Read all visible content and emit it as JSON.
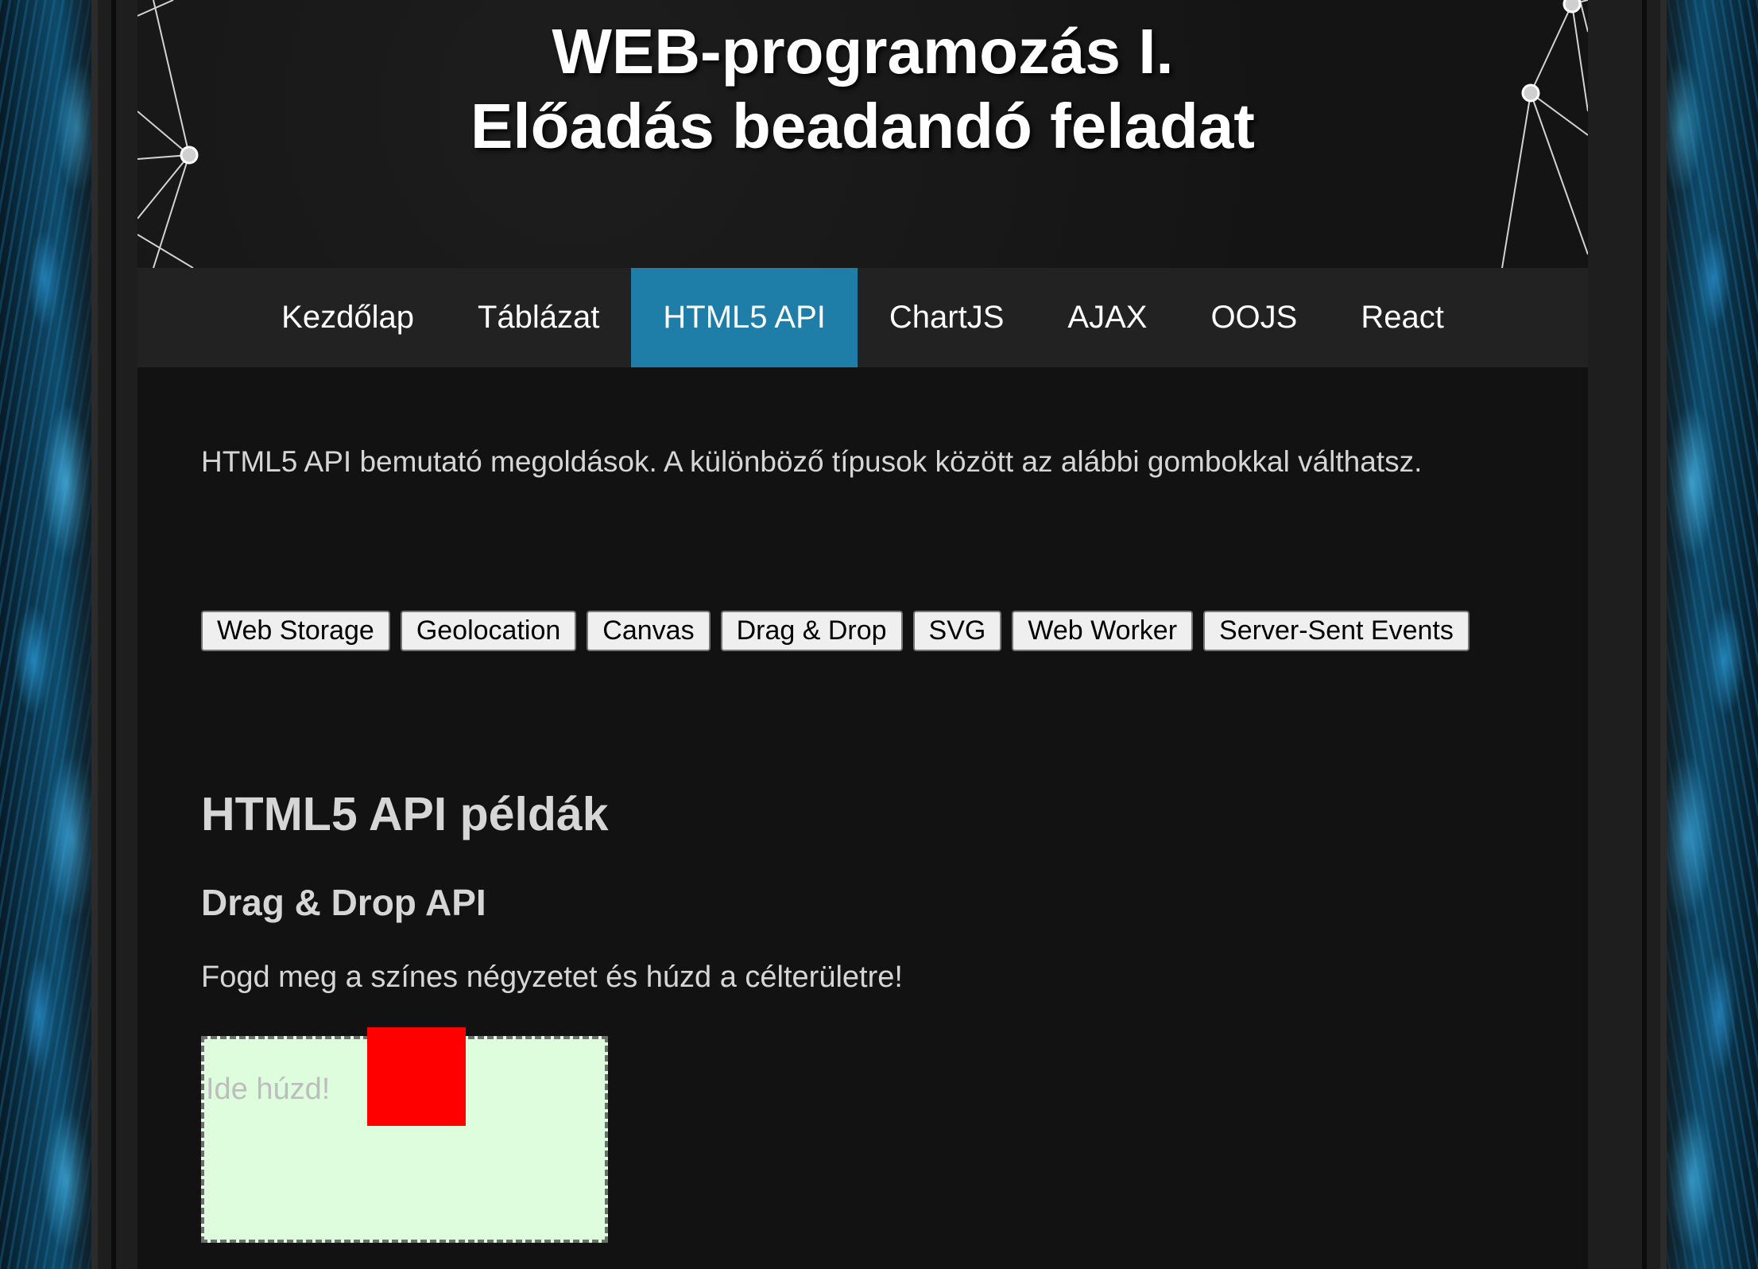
{
  "header": {
    "title_line1": "WEB-programozás I.",
    "title_line2": "Előadás beadandó feladat"
  },
  "nav": {
    "items": [
      {
        "label": "Kezdőlap",
        "active": false
      },
      {
        "label": "Táblázat",
        "active": false
      },
      {
        "label": "HTML5 API",
        "active": true
      },
      {
        "label": "ChartJS",
        "active": false
      },
      {
        "label": "AJAX",
        "active": false
      },
      {
        "label": "OOJS",
        "active": false
      },
      {
        "label": "React",
        "active": false
      }
    ],
    "active_color": "#1f7ea8"
  },
  "main": {
    "intro": "HTML5 API bemutató megoldások. A különböző típusok között az alábbi gombokkal válthatsz.",
    "api_buttons": [
      "Web Storage",
      "Geolocation",
      "Canvas",
      "Drag & Drop",
      "SVG",
      "Web Worker",
      "Server-Sent Events"
    ],
    "section_title": "HTML5 API példák",
    "sub_title": "Drag & Drop API",
    "instructions": "Fogd meg a színes négyzetet és húzd a célterületre!",
    "drop_zone": {
      "label": "Ide húzd!",
      "background": "#ddfddd"
    },
    "drag_item": {
      "color": "#ff0000"
    }
  },
  "colors": {
    "page_background": "#121212",
    "nav_background": "#222222",
    "side_accent": "#1e8cc8"
  }
}
